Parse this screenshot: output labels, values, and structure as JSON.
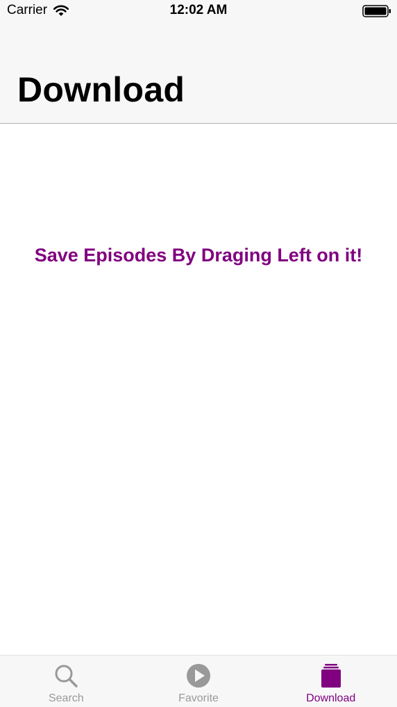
{
  "status_bar": {
    "carrier": "Carrier",
    "time": "12:02 AM",
    "wifi_icon": "wifi-icon",
    "battery_icon": "battery-icon"
  },
  "nav": {
    "title": "Download"
  },
  "main": {
    "empty_message": "Save Episodes By Draging Left on it!"
  },
  "tab_bar": {
    "tabs": [
      {
        "label": "Search",
        "icon": "search-icon",
        "active": false
      },
      {
        "label": "Favorite",
        "icon": "play-icon",
        "active": false
      },
      {
        "label": "Download",
        "icon": "download-icon",
        "active": true
      }
    ]
  },
  "colors": {
    "accent": "#800080",
    "inactive": "#999999",
    "bar_background": "#f7f7f7"
  }
}
